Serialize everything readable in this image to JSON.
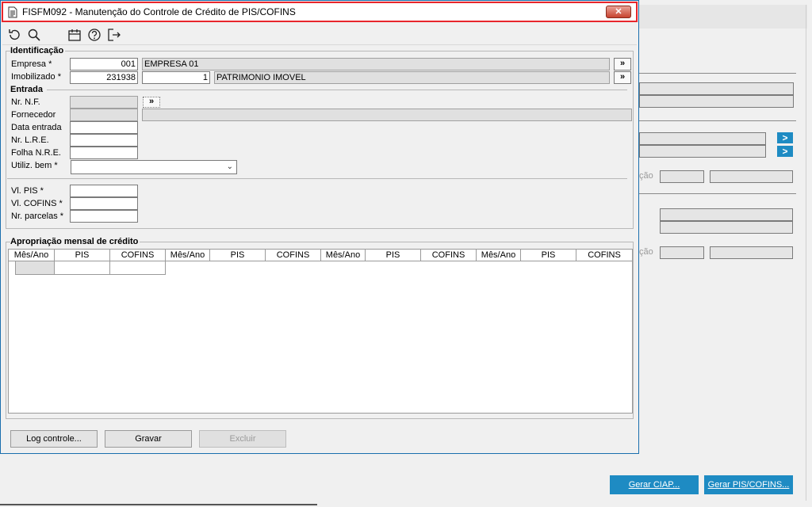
{
  "background": {
    "label_text": "ção",
    "gerar_ciap": "Gerar CIAP...",
    "gerar_pis_cofins": "Gerar PIS/COFINS...",
    "arrow": ">"
  },
  "dialog": {
    "title": "FISFM092 - Manutenção do Controle de Crédito de PIS/COFINS",
    "close_label": "✕",
    "toolbar": [
      "undo-icon",
      "search-icon",
      "calendar-icon",
      "help-icon",
      "exit-icon"
    ],
    "identificacao": {
      "section": "Identificação",
      "empresa_label": "Empresa *",
      "empresa_code": "001",
      "empresa_name": "EMPRESA 01",
      "imobilizado_label": "Imobilizado *",
      "imobilizado_code": "231938",
      "imobilizado_seq": "1",
      "imobilizado_desc": "PATRIMONIO IMOVEL",
      "lookup": "»"
    },
    "entrada": {
      "section": "Entrada",
      "nr_nf_label": "Nr. N.F.",
      "fornecedor_label": "Fornecedor",
      "data_entrada_label": "Data entrada",
      "nr_lre_label": "Nr. L.R.E.",
      "folha_nre_label": "Folha N.R.E.",
      "utiliz_bem_label": "Utiliz. bem *",
      "vl_pis_label": "Vl. PIS *",
      "vl_cofins_label": "Vl. COFINS *",
      "nr_parcelas_label": "Nr. parcelas *",
      "lookup": "»"
    },
    "apropriacao": {
      "section": "Apropriação mensal de crédito",
      "columns": [
        "Mês/Ano",
        "PIS",
        "COFINS",
        "Mês/Ano",
        "PIS",
        "COFINS",
        "Mês/Ano",
        "PIS",
        "COFINS",
        "Mês/Ano",
        "PIS",
        "COFINS"
      ]
    },
    "buttons": {
      "log": "Log controle...",
      "gravar": "Gravar",
      "excluir": "Excluir"
    }
  }
}
